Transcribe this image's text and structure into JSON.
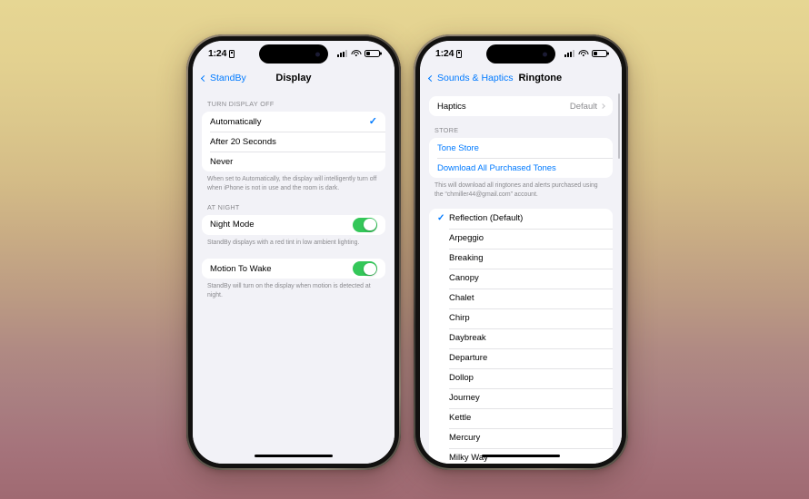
{
  "background": {
    "top_color": "#e6d693",
    "bottom_color": "#a06a72"
  },
  "accent_colors": {
    "blue": "#007aff",
    "green": "#34c759",
    "gray_text": "#8a8a8e"
  },
  "status_bar": {
    "time": "1:24",
    "lock_icon": "lock-icon",
    "signal_icon": "cellular-signal-icon",
    "wifi_icon": "wifi-icon",
    "battery_icon": "battery-icon"
  },
  "left_phone": {
    "nav": {
      "back_label": "StandBy",
      "title": "Display"
    },
    "sections": [
      {
        "header": "TURN DISPLAY OFF",
        "rows": [
          {
            "label": "Automatically",
            "checked": true
          },
          {
            "label": "After 20 Seconds",
            "checked": false
          },
          {
            "label": "Never",
            "checked": false
          }
        ],
        "footnote": "When set to Automatically, the display will intelligently turn off when iPhone is not in use and the room is dark."
      },
      {
        "header": "AT NIGHT",
        "rows": [
          {
            "label": "Night Mode",
            "toggle": "on"
          }
        ],
        "footnote": "StandBy displays with a red tint in low ambient lighting."
      },
      {
        "header": "",
        "rows": [
          {
            "label": "Motion To Wake",
            "toggle": "on"
          }
        ],
        "footnote": "StandBy will turn on the display when motion is detected at night."
      }
    ]
  },
  "right_phone": {
    "nav": {
      "back_label": "Sounds & Haptics",
      "title": "Ringtone"
    },
    "haptics": {
      "label": "Haptics",
      "value": "Default"
    },
    "store": {
      "header": "STORE",
      "items": [
        "Tone Store",
        "Download All Purchased Tones"
      ],
      "footnote": "This will download all ringtones and alerts purchased using the “chmiller44@gmail.com” account."
    },
    "tones": [
      {
        "label": "Reflection (Default)",
        "selected": true
      },
      {
        "label": "Arpeggio",
        "selected": false
      },
      {
        "label": "Breaking",
        "selected": false
      },
      {
        "label": "Canopy",
        "selected": false
      },
      {
        "label": "Chalet",
        "selected": false
      },
      {
        "label": "Chirp",
        "selected": false
      },
      {
        "label": "Daybreak",
        "selected": false
      },
      {
        "label": "Departure",
        "selected": false
      },
      {
        "label": "Dollop",
        "selected": false
      },
      {
        "label": "Journey",
        "selected": false
      },
      {
        "label": "Kettle",
        "selected": false
      },
      {
        "label": "Mercury",
        "selected": false
      },
      {
        "label": "Milky Way",
        "selected": false
      }
    ]
  }
}
